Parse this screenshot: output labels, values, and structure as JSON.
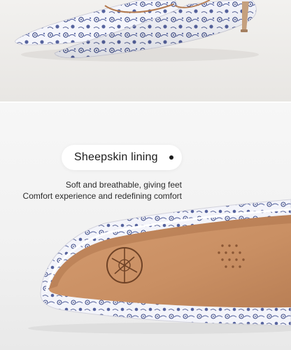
{
  "feature": {
    "title": "Sheepskin lining",
    "lines": [
      "Soft and breathable, giving feet",
      "Comfort experience and redefining comfort"
    ]
  },
  "colors": {
    "porcelain_blue": "#3c4a86",
    "leather_tan": "#c98f63",
    "background": "#f3f3f3",
    "heel": "#c5a07e"
  },
  "icons": [
    "shoe-photo",
    "insole-logo-icon",
    "perforation-dots"
  ]
}
